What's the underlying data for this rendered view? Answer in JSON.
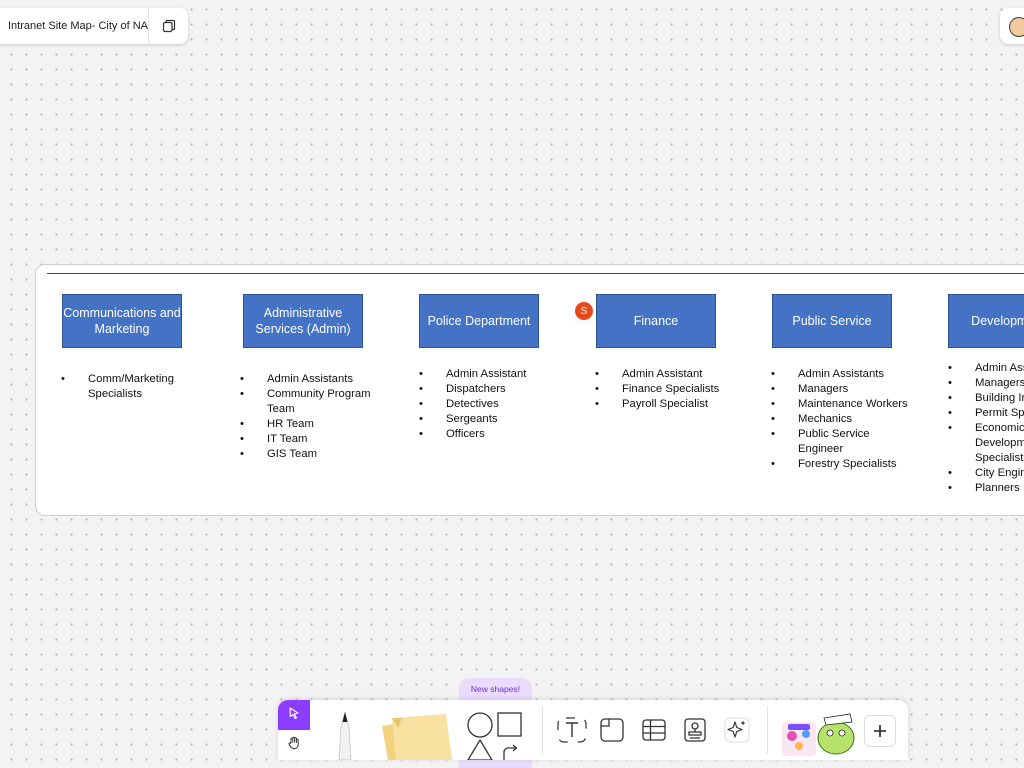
{
  "header": {
    "title": "Intranet Site Map- City of NA"
  },
  "cursor": {
    "initial": "S",
    "color": "#e6491d"
  },
  "colors": {
    "dept_fill": "#4472c4",
    "dept_border": "#2f528f",
    "accent": "#8b3dff"
  },
  "departments": [
    {
      "name": "Communications and Marketing",
      "items": [
        "Comm/Marketing Specialists"
      ]
    },
    {
      "name": "Administrative Services (Admin)",
      "items": [
        "Admin Assistants",
        "Community Program Team",
        "HR Team",
        "IT Team",
        "GIS Team"
      ]
    },
    {
      "name": "Police Department",
      "items": [
        "Admin Assistant",
        "Dispatchers",
        "Detectives",
        "Sergeants",
        "Officers"
      ]
    },
    {
      "name": "Finance",
      "items": [
        "Admin Assistant",
        "Finance Specialists",
        "Payroll Specialist"
      ]
    },
    {
      "name": "Public Service",
      "items": [
        "Admin Assistants",
        "Managers",
        "Maintenance Workers",
        "Mechanics",
        "Public Service Engineer",
        "Forestry Specialists"
      ]
    },
    {
      "name": "Development",
      "items": [
        "Admin Assistants",
        "Managers",
        "Building Inspectors",
        "Permit Specialists",
        "Economic Development Specialists",
        "City Engineers",
        "Planners"
      ]
    }
  ],
  "toolbar": {
    "new_shapes_label": "New shapes!",
    "tools": [
      "select-icon",
      "hand-icon",
      "pen-icon",
      "sticky-note-icon",
      "shapes-icon",
      "text-icon",
      "frame-icon",
      "table-icon",
      "stamp-icon",
      "ai-sparkle-icon",
      "stickers-icon",
      "add-icon"
    ]
  }
}
